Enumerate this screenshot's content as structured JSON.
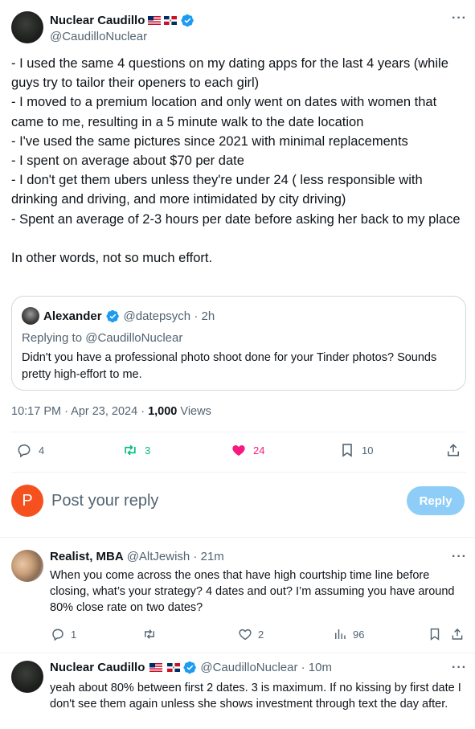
{
  "author": {
    "name": "Nuclear Caudillo",
    "handle": "@CaudilloNuclear"
  },
  "tweet": {
    "text": "- I used the same 4 questions on my dating apps for the last 4 years (while guys try to tailor their openers to each girl)\n- I moved to a premium location and only went on dates with women that came to me, resulting in a 5 minute walk to the date location\n- I've used the same pictures since 2021 with minimal replacements\n- I spent on average about $70 per date\n- I don't get them ubers unless they're under 24 ( less responsible with drinking and driving, and more intimidated by city driving)\n- Spent an average of 2-3 hours per date before asking her back to my place\n\nIn other words, not so much effort.",
    "time": "10:17 PM · Apr 23, 2024 · ",
    "views_count": "1,000",
    "views_label": " Views"
  },
  "quote": {
    "name": "Alexander",
    "handle_time": "@datepsych · 2h",
    "replying_prefix": "Replying to ",
    "replying_to": "@CaudilloNuclear",
    "text": "Didn't you have a professional photo shoot done for your Tinder photos? Sounds pretty high-effort to me."
  },
  "actions": {
    "replies": "4",
    "retweets": "3",
    "likes": "24",
    "bookmarks": "10"
  },
  "reply_box": {
    "avatar_letter": "P",
    "placeholder": "Post your reply",
    "button": "Reply"
  },
  "replies": [
    {
      "name": "Realist, MBA",
      "handle_time": "@AltJewish · 21m",
      "text": "When you come across the ones that have high courtship time line before closing, what’s your strategy? 4 dates and out? I’m assuming you have around 80% close rate on two dates?",
      "reply_count": "1",
      "retweet_count": "",
      "like_count": "2",
      "views": "96"
    },
    {
      "name": "Nuclear Caudillo",
      "handle_time": "@CaudilloNuclear · 10m",
      "text": "yeah about 80% between first 2 dates. 3 is maximum. If no kissing by first date I don't see them again unless she shows investment through text the day after."
    }
  ],
  "colors": {
    "accent": "#1d9bf0",
    "retweet": "#00ba7c",
    "like": "#f91880",
    "reply_button": "#8ecdf7",
    "profile_letter_bg": "#f4511e"
  },
  "icons": {
    "verified": "verified-badge-icon",
    "reply": "speech-bubble-icon",
    "retweet": "retweet-arrows-icon",
    "like": "heart-icon",
    "bookmark": "bookmark-icon",
    "share": "share-upload-icon",
    "views": "bar-chart-icon",
    "more": "ellipsis-icon",
    "flags": [
      "us-flag-icon",
      "dominican-flag-icon"
    ]
  }
}
